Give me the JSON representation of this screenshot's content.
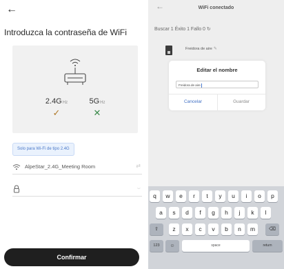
{
  "left": {
    "title": "Introduzca la contraseña de WiFi",
    "bands": [
      {
        "freq": "2.4G",
        "unit": "Hz",
        "mark": "✓"
      },
      {
        "freq": "5G",
        "unit": "Hz",
        "mark": "✕"
      }
    ],
    "note": "Solo para Wi-Fi de tipo 2.4G",
    "ssid": "AlpeStar_2.4G_Meeting Room",
    "confirm_label": "Confirmar"
  },
  "right": {
    "title": "WiFi conectado",
    "status": "Buscar 1 Éxito 1 Fallo 0 ↻",
    "device_name": "Freidora de aire",
    "dialog": {
      "title": "Editar el nombre",
      "input_value": "Freidora de aire",
      "cancel_label": "Cancelar",
      "save_label": "Guardar"
    },
    "keyboard": {
      "row1": [
        "q",
        "w",
        "e",
        "r",
        "t",
        "y",
        "u",
        "i",
        "o",
        "p"
      ],
      "row2": [
        "a",
        "s",
        "d",
        "f",
        "g",
        "h",
        "j",
        "k",
        "l"
      ],
      "row3": [
        "z",
        "x",
        "c",
        "v",
        "b",
        "n",
        "m"
      ],
      "shift": "⇧",
      "backspace": "⌫",
      "numbers": "123",
      "emoji": "☺",
      "space": "space",
      "return": "return"
    }
  },
  "colors": {
    "confirm_bg": "#1f1f1f",
    "accent_blue": "#3f6fc4",
    "check_ok": "#b07a2a",
    "cross": "#3a8a4a"
  }
}
